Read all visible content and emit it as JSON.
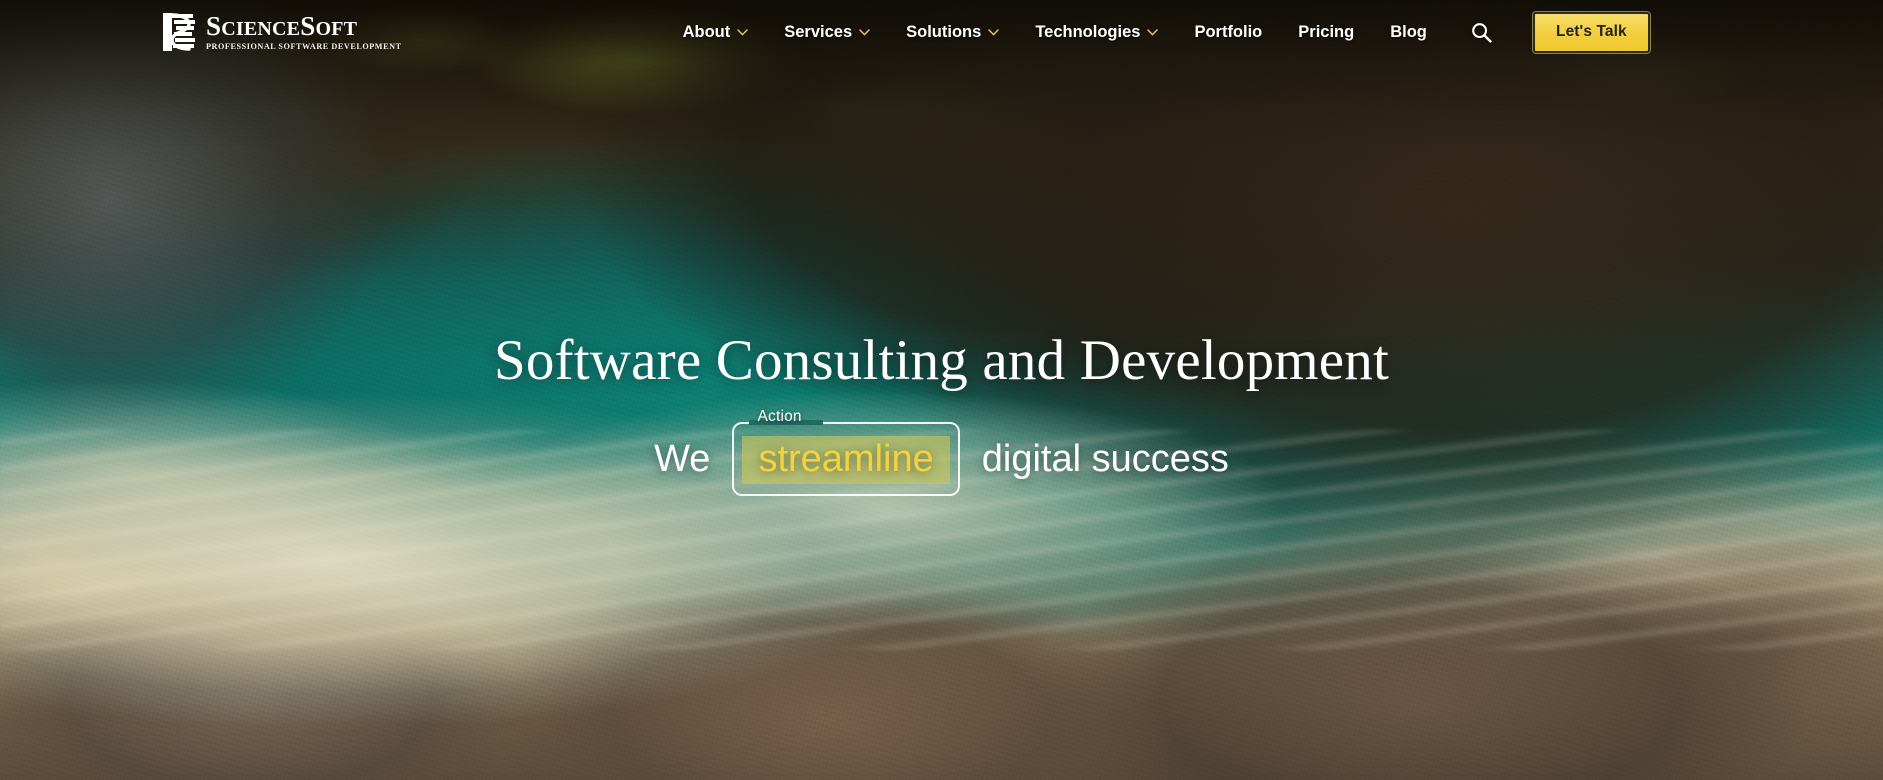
{
  "brand": {
    "name_science": "Science",
    "name_soft": "Soft",
    "name_full": "ScienceSoft",
    "tagline": "Professional Software Development",
    "logo_icon": "sciencesoft-s-mark-icon"
  },
  "header": {
    "nav": [
      {
        "label": "About",
        "has_dropdown": true,
        "icon": "chevron-down-icon"
      },
      {
        "label": "Services",
        "has_dropdown": true,
        "icon": "chevron-down-icon"
      },
      {
        "label": "Solutions",
        "has_dropdown": true,
        "icon": "chevron-down-icon"
      },
      {
        "label": "Technologies",
        "has_dropdown": true,
        "icon": "chevron-down-icon"
      },
      {
        "label": "Portfolio",
        "has_dropdown": false,
        "icon": ""
      },
      {
        "label": "Pricing",
        "has_dropdown": false,
        "icon": ""
      },
      {
        "label": "Blog",
        "has_dropdown": false,
        "icon": ""
      }
    ],
    "search_icon": "search-icon",
    "cta_label": "Let's Talk"
  },
  "hero": {
    "title": "Software Consulting and Development",
    "subtitle_prefix": "We",
    "subtitle_suffix": "digital success",
    "rotating_word": "streamline"
  },
  "annotation": {
    "label": "Action",
    "target_text": "streamline"
  },
  "colors": {
    "accent_yellow": "#f2cf3f",
    "cta_text": "#23231c",
    "chevron": "#e8c84a",
    "nav_text": "#ffffff",
    "highlight_bg": "rgba(205,198,90,0.62)",
    "highlight_text": "#f5d23c",
    "annotation_border": "#ffffff",
    "water_teal": "#0f8076",
    "foam_cream": "#b9ad8e",
    "rock_brown": "#6d5a45"
  }
}
